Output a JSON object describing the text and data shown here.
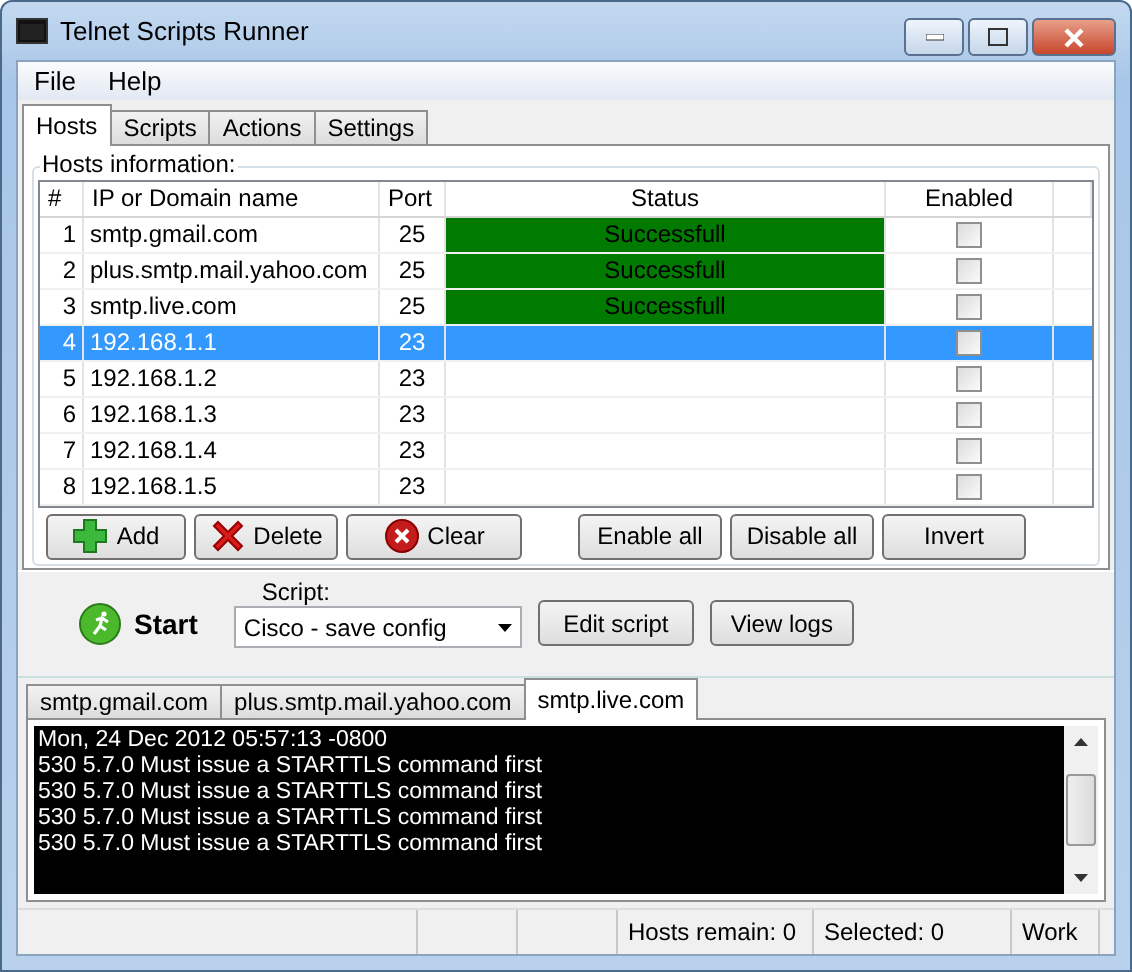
{
  "window": {
    "title": "Telnet Scripts Runner"
  },
  "menu": [
    "File",
    "Help"
  ],
  "tabs": [
    {
      "label": "Hosts",
      "selected": true
    },
    {
      "label": "Scripts",
      "selected": false
    },
    {
      "label": "Actions",
      "selected": false
    },
    {
      "label": "Settings",
      "selected": false
    }
  ],
  "hosts": {
    "title": "Hosts information:",
    "columns": [
      "#",
      "IP or Domain name",
      "Port",
      "Status",
      "Enabled"
    ],
    "rows": [
      {
        "num": "1",
        "host": "smtp.gmail.com",
        "port": "25",
        "status": "Successfull",
        "selected": false,
        "enabled": false
      },
      {
        "num": "2",
        "host": "plus.smtp.mail.yahoo.com",
        "port": "25",
        "status": "Successfull",
        "selected": false,
        "enabled": false
      },
      {
        "num": "3",
        "host": "smtp.live.com",
        "port": "25",
        "status": "Successfull",
        "selected": false,
        "enabled": false
      },
      {
        "num": "4",
        "host": "192.168.1.1",
        "port": "23",
        "selected": true,
        "enabled": false
      },
      {
        "num": "5",
        "host": "192.168.1.2",
        "port": "23",
        "selected": false,
        "enabled": false
      },
      {
        "num": "6",
        "host": "192.168.1.3",
        "port": "23",
        "selected": false,
        "enabled": false
      },
      {
        "num": "7",
        "host": "192.168.1.4",
        "port": "23",
        "selected": false,
        "enabled": false
      },
      {
        "num": "8",
        "host": "192.168.1.5",
        "port": "23",
        "selected": false,
        "enabled": false
      }
    ],
    "buttons": [
      {
        "label": "Add",
        "kind": "add"
      },
      {
        "label": "Delete",
        "kind": "delete"
      },
      {
        "label": "Clear",
        "kind": "clear"
      },
      {
        "label": "Enable all",
        "kind": "plain"
      },
      {
        "label": "Disable all",
        "kind": "plain"
      },
      {
        "label": "Invert",
        "kind": "plain"
      }
    ]
  },
  "run": {
    "start": "Start",
    "script_label": "Script:",
    "script_value": "Cisco - save config",
    "buttons": [
      "Edit script",
      "View logs"
    ]
  },
  "log_tabs": [
    {
      "label": "smtp.gmail.com",
      "selected": false
    },
    {
      "label": "plus.smtp.mail.yahoo.com",
      "selected": false
    },
    {
      "label": "smtp.live.com",
      "selected": true
    }
  ],
  "log_lines": [
    "Mon, 24 Dec 2012 05:57:13 -0800",
    "530 5.7.0 Must issue a STARTTLS command first",
    "530 5.7.0 Must issue a STARTTLS command first",
    "530 5.7.0 Must issue a STARTTLS command first",
    "530 5.7.0 Must issue a STARTTLS command first"
  ],
  "status_bar": [
    "Hosts remain: 0",
    "Selected: 0",
    "Work"
  ]
}
